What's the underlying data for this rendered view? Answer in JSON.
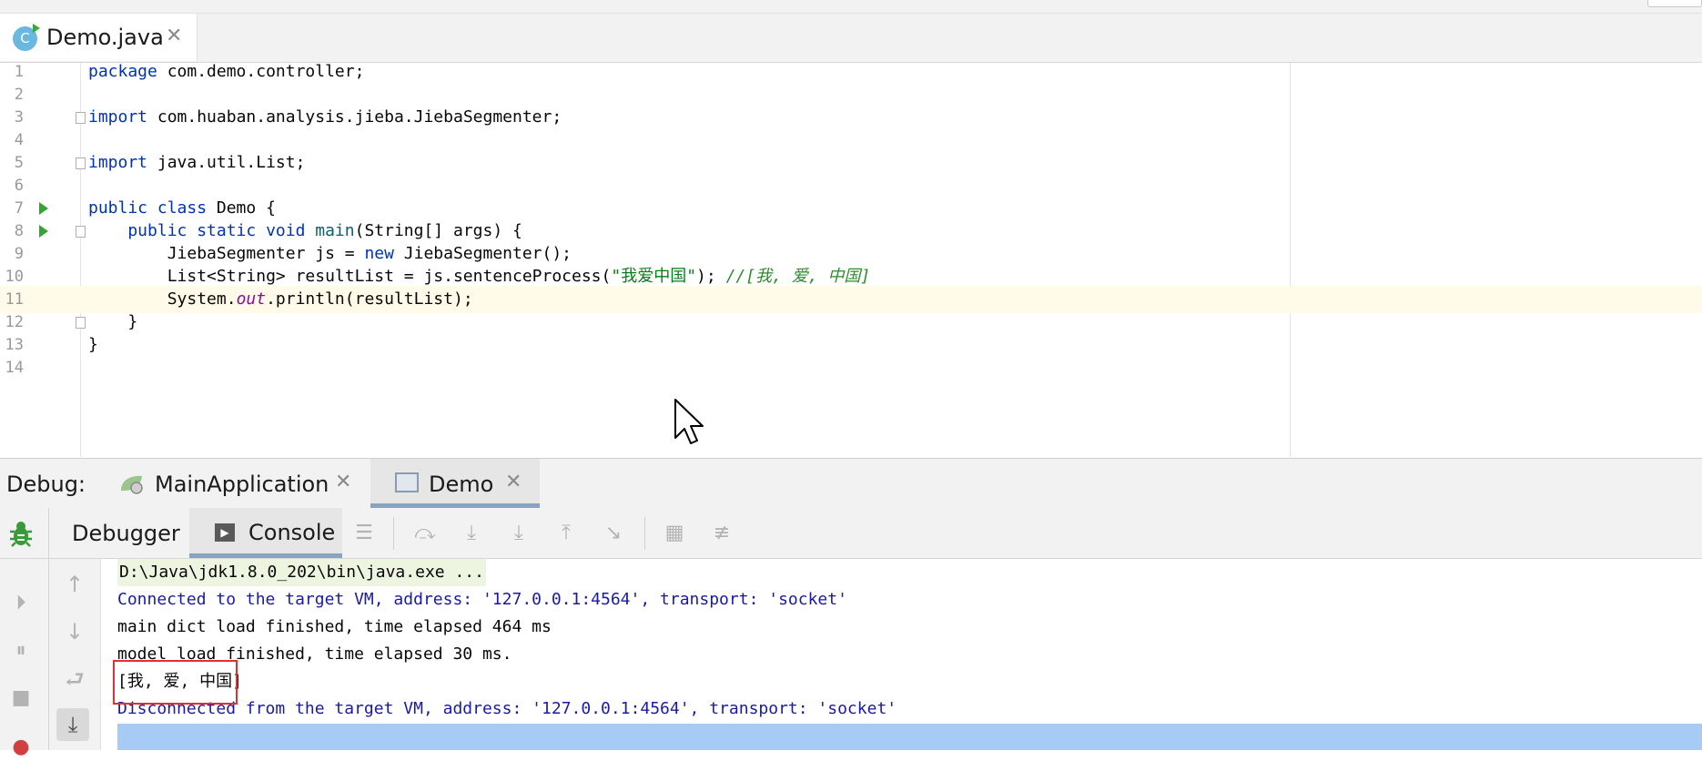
{
  "editor_tab": {
    "icon_letter": "C",
    "file_name": "Demo.java",
    "close": "✕"
  },
  "code_lines": [
    {
      "n": "1"
    },
    {
      "n": "2"
    },
    {
      "n": "3"
    },
    {
      "n": "4"
    },
    {
      "n": "5"
    },
    {
      "n": "6"
    },
    {
      "n": "7"
    },
    {
      "n": "8"
    },
    {
      "n": "9"
    },
    {
      "n": "10"
    },
    {
      "n": "11"
    },
    {
      "n": "12"
    },
    {
      "n": "13"
    },
    {
      "n": "14"
    }
  ],
  "code": {
    "l1_kw": "package",
    "l1_rest": " com.demo.controller;",
    "l3_kw": "import",
    "l3_rest": " com.huaban.analysis.jieba.JiebaSegmenter;",
    "l5_kw": "import",
    "l5_rest": " java.util.List;",
    "l7_kw": "public class",
    "l7_rest": " Demo {",
    "l8_kw": "    public static void",
    "l8_fn": " main",
    "l8_rest": "(String[] args) {",
    "l9_a": "        JiebaSegmenter js = ",
    "l9_kw": "new",
    "l9_b": " JiebaSegmenter();",
    "l10_a": "        List<String> resultList = js.sentenceProcess(",
    "l10_str": "\"我爱中国\"",
    "l10_b": "); ",
    "l10_cm": "//[我, 爱, 中国]",
    "l11_a": "        System.",
    "l11_fld": "out",
    "l11_b": ".println(resultList);",
    "l12": "    }",
    "l13": "}"
  },
  "debug_panel": {
    "label": "Debug:",
    "tabs": [
      {
        "label": "MainApplication",
        "close": "✕"
      },
      {
        "label": "Demo",
        "close": "✕"
      }
    ]
  },
  "toolbar": {
    "debugger_label": "Debugger",
    "console_label": "Console"
  },
  "console": {
    "lines": [
      "D:\\Java\\jdk1.8.0_202\\bin\\java.exe ...",
      "Connected to the target VM, address: '127.0.0.1:4564', transport: 'socket'",
      "main dict load finished, time elapsed 464 ms",
      "model load finished, time elapsed 30 ms.",
      "[我, 爱, 中国]",
      "Disconnected from the target VM, address: '127.0.0.1:4564', transport: 'socket'"
    ]
  },
  "colors": {
    "keyword": "#0033b3",
    "string": "#067d17",
    "console_blue": "#1a1aa6",
    "highlight_box": "#e03030",
    "run_green": "#36a336"
  }
}
